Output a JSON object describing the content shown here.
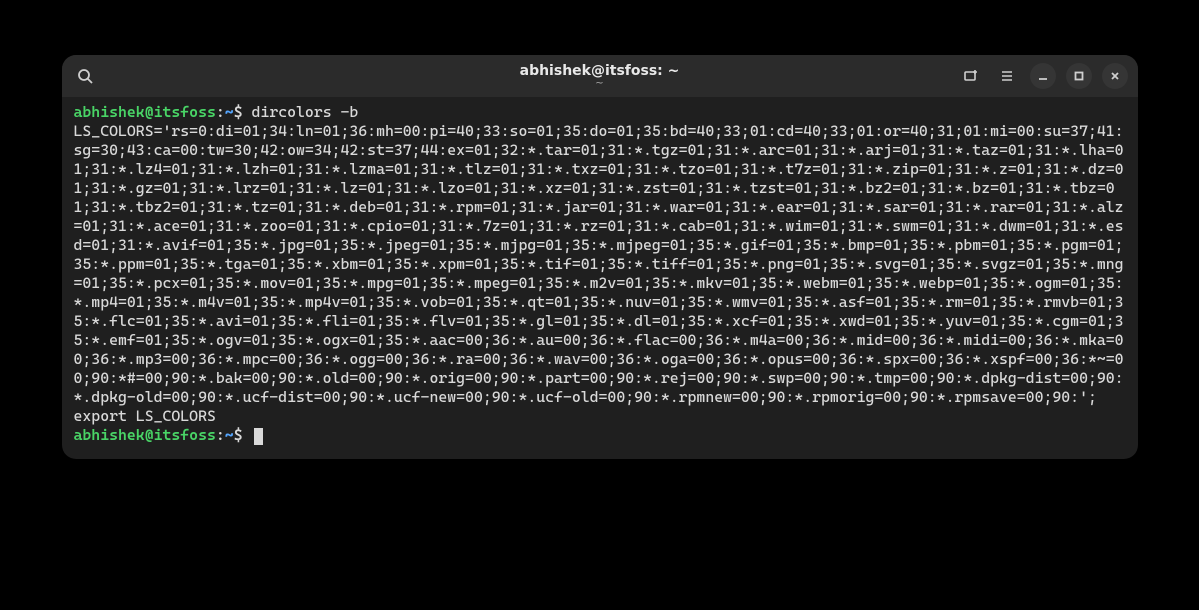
{
  "titlebar": {
    "title": "abhishek@itsfoss: ~",
    "subtitle": "~"
  },
  "prompt": {
    "user_host": "abhishek@itsfoss",
    "colon": ":",
    "path": "~",
    "dollar": "$"
  },
  "command": "dircolors -b",
  "output_ls_colors": "LS_COLORS='rs=0:di=01;34:ln=01;36:mh=00:pi=40;33:so=01;35:do=01;35:bd=40;33;01:cd=40;33;01:or=40;31;01:mi=00:su=37;41:sg=30;43:ca=00:tw=30;42:ow=34;42:st=37;44:ex=01;32:*.tar=01;31:*.tgz=01;31:*.arc=01;31:*.arj=01;31:*.taz=01;31:*.lha=01;31:*.lz4=01;31:*.lzh=01;31:*.lzma=01;31:*.tlz=01;31:*.txz=01;31:*.tzo=01;31:*.t7z=01;31:*.zip=01;31:*.z=01;31:*.dz=01;31:*.gz=01;31:*.lrz=01;31:*.lz=01;31:*.lzo=01;31:*.xz=01;31:*.zst=01;31:*.tzst=01;31:*.bz2=01;31:*.bz=01;31:*.tbz=01;31:*.tbz2=01;31:*.tz=01;31:*.deb=01;31:*.rpm=01;31:*.jar=01;31:*.war=01;31:*.ear=01;31:*.sar=01;31:*.rar=01;31:*.alz=01;31:*.ace=01;31:*.zoo=01;31:*.cpio=01;31:*.7z=01;31:*.rz=01;31:*.cab=01;31:*.wim=01;31:*.swm=01;31:*.dwm=01;31:*.esd=01;31:*.avif=01;35:*.jpg=01;35:*.jpeg=01;35:*.mjpg=01;35:*.mjpeg=01;35:*.gif=01;35:*.bmp=01;35:*.pbm=01;35:*.pgm=01;35:*.ppm=01;35:*.tga=01;35:*.xbm=01;35:*.xpm=01;35:*.tif=01;35:*.tiff=01;35:*.png=01;35:*.svg=01;35:*.svgz=01;35:*.mng=01;35:*.pcx=01;35:*.mov=01;35:*.mpg=01;35:*.mpeg=01;35:*.m2v=01;35:*.mkv=01;35:*.webm=01;35:*.webp=01;35:*.ogm=01;35:*.mp4=01;35:*.m4v=01;35:*.mp4v=01;35:*.vob=01;35:*.qt=01;35:*.nuv=01;35:*.wmv=01;35:*.asf=01;35:*.rm=01;35:*.rmvb=01;35:*.flc=01;35:*.avi=01;35:*.fli=01;35:*.flv=01;35:*.gl=01;35:*.dl=01;35:*.xcf=01;35:*.xwd=01;35:*.yuv=01;35:*.cgm=01;35:*.emf=01;35:*.ogv=01;35:*.ogx=01;35:*.aac=00;36:*.au=00;36:*.flac=00;36:*.m4a=00;36:*.mid=00;36:*.midi=00;36:*.mka=00;36:*.mp3=00;36:*.mpc=00;36:*.ogg=00;36:*.ra=00;36:*.wav=00;36:*.oga=00;36:*.opus=00;36:*.spx=00;36:*.xspf=00;36:*~=00;90:*#=00;90:*.bak=00;90:*.old=00;90:*.orig=00;90:*.part=00;90:*.rej=00;90:*.swp=00;90:*.tmp=00;90:*.dpkg-dist=00;90:*.dpkg-old=00;90:*.ucf-dist=00;90:*.ucf-new=00;90:*.ucf-old=00;90:*.rpmnew=00;90:*.rpmorig=00;90:*.rpmsave=00;90:';",
  "output_export": "export LS_COLORS"
}
